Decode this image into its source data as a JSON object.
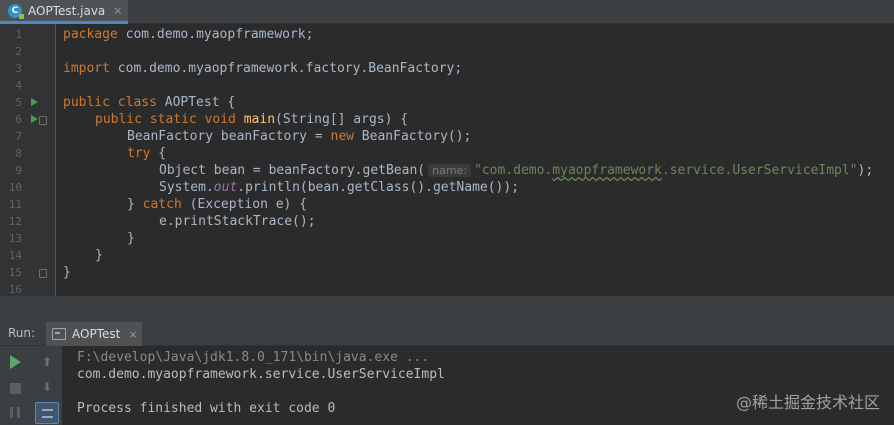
{
  "editor_tab": {
    "icon": "C",
    "label": "AOPTest.java",
    "close": "×"
  },
  "line_numbers": [
    "1",
    "2",
    "3",
    "4",
    "5",
    "6",
    "7",
    "8",
    "9",
    "10",
    "11",
    "12",
    "13",
    "14",
    "15",
    "16"
  ],
  "code": {
    "l1_kw": "package",
    "l1_rest": " com.demo.myaopframework;",
    "l3_kw": "import",
    "l3_rest": " com.demo.myaopframework.factory.BeanFactory;",
    "l5_kw": "public class",
    "l5_rest": " AOPTest {",
    "l6_kw": "public static void",
    "l6_fn": "main",
    "l6_rest": "(String[] args) {",
    "l7_a": "BeanFactory beanFactory = ",
    "l7_kw": "new",
    "l7_b": " BeanFactory();",
    "l8_kw": "try",
    "l8_rest": " {",
    "l9_a": "Object bean = beanFactory.getBean(",
    "l9_hint": "name:",
    "l9_str1": "\"com.demo.",
    "l9_str2": "myaopframework",
    "l9_str3": ".service.UserServiceImpl\"",
    "l9_end": ");",
    "l10_a": "System.",
    "l10_it": "out",
    "l10_b": ".println(bean.getClass().getName());",
    "l11_a": "} ",
    "l11_kw": "catch",
    "l11_b": " (Exception e) {",
    "l12": "e.printStackTrace();",
    "l13": "}",
    "l14": "}",
    "l15": "}"
  },
  "run_panel": {
    "title": "Run:",
    "tab_label": "AOPTest",
    "tab_close": "×",
    "up_arrow": "⬆",
    "down_arrow": "⬇",
    "output": [
      "F:\\develop\\Java\\jdk1.8.0_171\\bin\\java.exe ...",
      "com.demo.myaopframework.service.UserServiceImpl",
      "Process finished with exit code 0"
    ]
  },
  "watermark": "@稀土掘金技术社区",
  "colors": {
    "keyword": "#cc7832",
    "method": "#ffc66d",
    "string": "#6a8759",
    "static_field": "#9876aa",
    "run_green": "#59a869"
  }
}
